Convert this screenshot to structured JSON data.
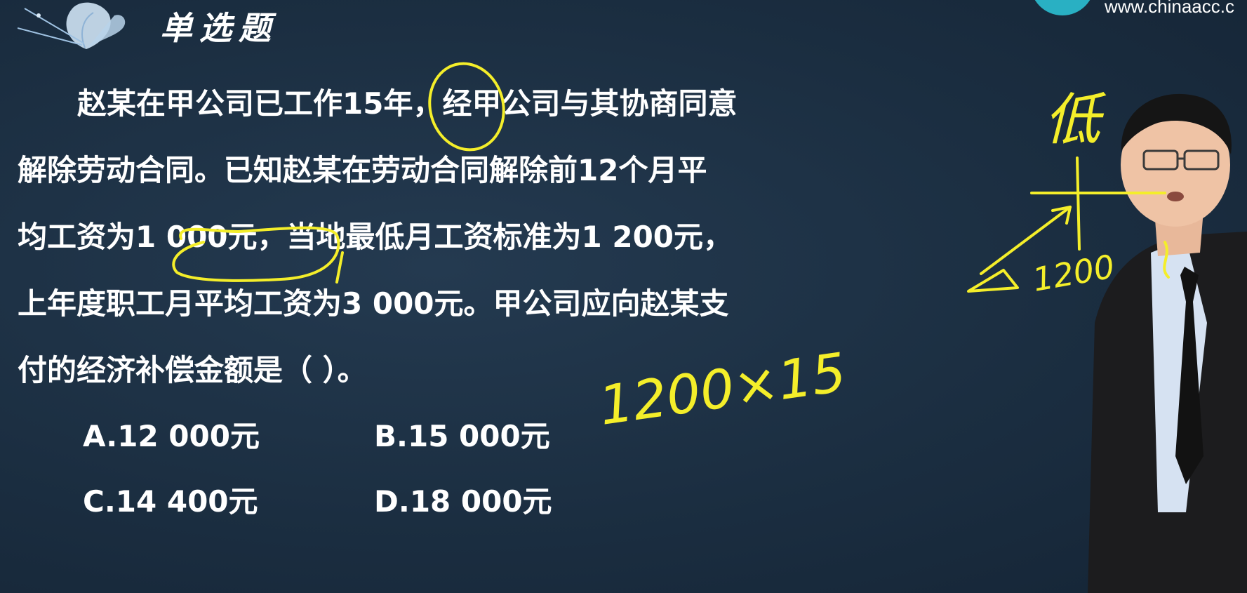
{
  "header": {
    "section_title": "单选题",
    "watermark": "www.chinaacc.c"
  },
  "question": {
    "lines": [
      "赵某在甲公司已工作15年，经甲公司与其协商同意",
      "解除劳动合同。已知赵某在劳动合同解除前12个月平",
      "均工资为1 000元，当地最低月工资标准为1 200元，",
      "上年度职工月平均工资为3 000元。甲公司应向赵某支",
      "付的经济补偿金额是（  ）。"
    ]
  },
  "options": [
    {
      "label": "A.12 000元"
    },
    {
      "label": "B.15 000元"
    },
    {
      "label": "C.14 400元"
    },
    {
      "label": "D.18 000元"
    }
  ],
  "annotations": {
    "low_char": "低",
    "calc": "1200×15",
    "small_1200": "1200"
  },
  "colors": {
    "background": "#1d3144",
    "text": "#ffffff",
    "annotation": "#f4ee2a",
    "logo": "#29b0c3"
  }
}
